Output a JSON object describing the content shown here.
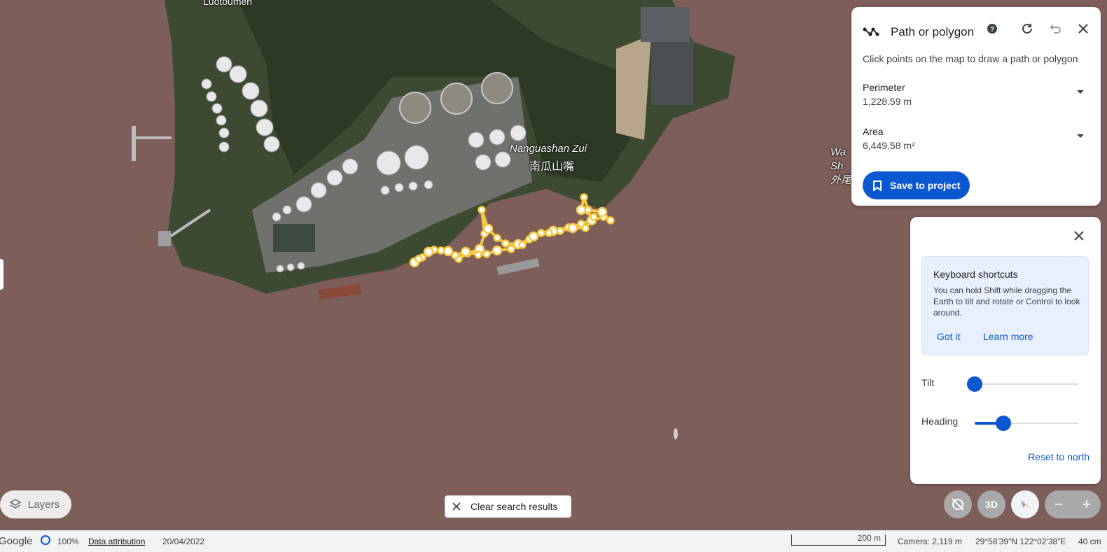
{
  "map": {
    "place_name_en": "Nanguashan Zui",
    "place_name_zh": "南瓜山嘴",
    "label_top_partial": "Luotoumen",
    "label_right_partial_lines": [
      "Wa",
      "Sh",
      "外尾"
    ]
  },
  "path_panel": {
    "title": "Path or polygon",
    "instructions": "Click points on the map to draw a path or polygon",
    "perimeter_label": "Perimeter",
    "perimeter_value": "1,228.59 m",
    "area_label": "Area",
    "area_value": "6,449.58 m²",
    "save_button": "Save to project",
    "icons": [
      "path-icon",
      "help-icon",
      "refresh-icon",
      "undo-icon",
      "close-icon"
    ]
  },
  "nav_panel": {
    "kb_title": "Keyboard shortcuts",
    "kb_text": "You can hold Shift while dragging the Earth to tilt and rotate or Control to look around.",
    "got_it": "Got it",
    "learn_more": "Learn more",
    "tilt_label": "Tilt",
    "tilt_value": 0,
    "heading_label": "Heading",
    "heading_value": 0.28,
    "reset_north": "Reset to north"
  },
  "controls": {
    "layers": "Layers",
    "clear_search": "Clear search results",
    "three_d": "3D"
  },
  "status": {
    "brand": "Google",
    "load_pct": "100%",
    "data_attribution": "Data attribution",
    "imagery_date": "20/04/2022",
    "scale": "200 m",
    "camera": "Camera: 2,119 m",
    "coords": "29°58′39″N 122°02′38″E",
    "elevation": "40 cm"
  },
  "colors": {
    "accent": "#0b57d0",
    "water": "#7d5e59",
    "path": "#f5c842"
  }
}
